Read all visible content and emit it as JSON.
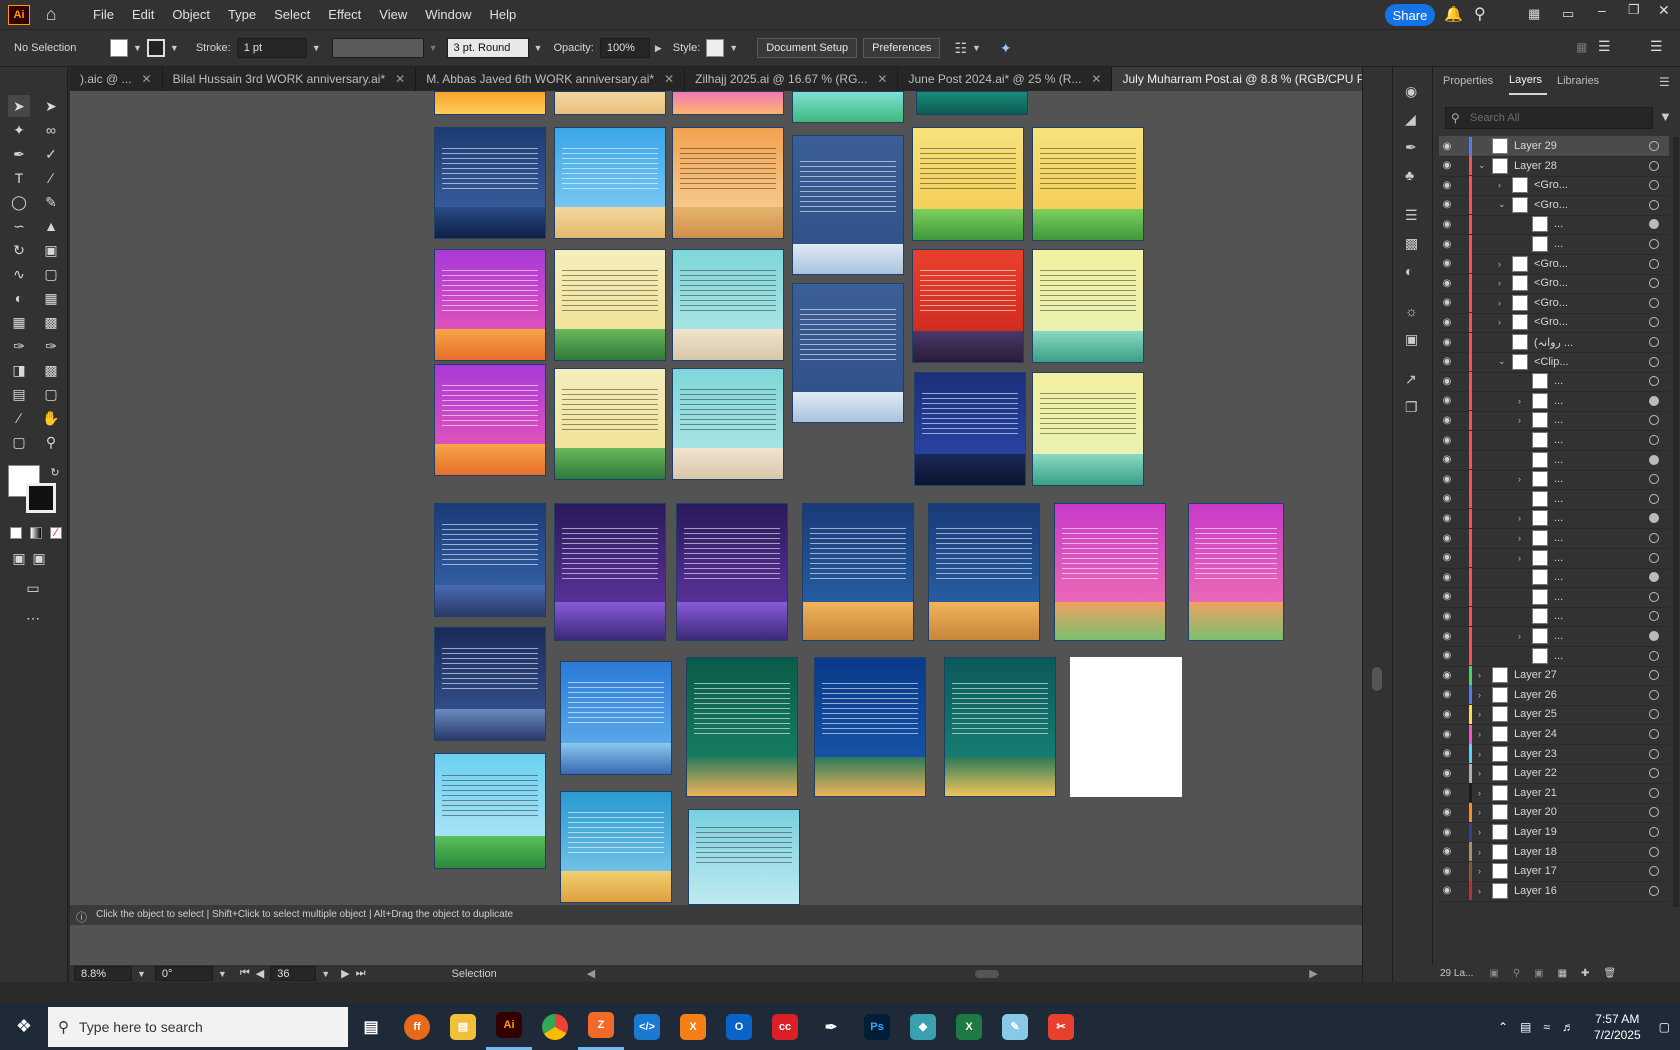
{
  "app": {
    "logo": "Ai"
  },
  "menu": [
    "File",
    "Edit",
    "Object",
    "Type",
    "Select",
    "Effect",
    "View",
    "Window",
    "Help"
  ],
  "share_label": "Share",
  "control": {
    "selection": "No Selection",
    "stroke_label": "Stroke:",
    "stroke_value": "1 pt",
    "brush": "3 pt. Round",
    "opacity_label": "Opacity:",
    "opacity_value": "100%",
    "style_label": "Style:",
    "document_setup": "Document Setup",
    "preferences": "Preferences"
  },
  "tabs": [
    {
      "label": ").aic @ ..."
    },
    {
      "label": "Bilal Hussain  3rd  WORK anniversary.ai*"
    },
    {
      "label": "M. Abbas Javed  6th  WORK anniversary.ai*"
    },
    {
      "label": "Zilhajj 2025.ai @ 16.67 % (RG..."
    },
    {
      "label": "June Post 2024.ai* @ 25 % (R..."
    },
    {
      "label": "July Muharram Post.ai @ 8.8 % (RGB/CPU Preview)"
    }
  ],
  "status": {
    "hint": "Click the object to select  |  Shift+Click to select multiple object  |  Alt+Drag the object to duplicate",
    "zoom": "8.8%",
    "rotation": "0°",
    "artboard": "36",
    "tool": "Selection"
  },
  "panel": {
    "tabs": [
      "Properties",
      "Layers",
      "Libraries"
    ],
    "search_placeholder": "Search All",
    "layer_count": "29 La...",
    "layers": [
      {
        "name": "Layer 29",
        "color": "#4f7cff",
        "selected": true,
        "twist": "",
        "indent": 0
      },
      {
        "name": "Layer 28",
        "color": "#ff5050",
        "twist": "v",
        "indent": 0
      },
      {
        "name": "<Gro...",
        "color": "#ff5050",
        "twist": ">",
        "indent": 1
      },
      {
        "name": "<Gro...",
        "color": "#ff5050",
        "twist": "v",
        "indent": 1
      },
      {
        "name": "...",
        "color": "#ff5050",
        "twist": "",
        "indent": 2
      },
      {
        "name": "...",
        "color": "#ff5050",
        "twist": "",
        "indent": 2
      },
      {
        "name": "<Gro...",
        "color": "#ff5050",
        "twist": ">",
        "indent": 1
      },
      {
        "name": "<Gro...",
        "color": "#ff5050",
        "twist": ">",
        "indent": 1
      },
      {
        "name": "<Gro...",
        "color": "#ff5050",
        "twist": ">",
        "indent": 1
      },
      {
        "name": "<Gro...",
        "color": "#ff5050",
        "twist": ">",
        "indent": 1
      },
      {
        "name": "(روانہ ...",
        "color": "#ff5050",
        "twist": "",
        "indent": 1
      },
      {
        "name": "<Clip...",
        "color": "#ff5050",
        "twist": "v",
        "indent": 1
      },
      {
        "name": "...",
        "color": "#ff5050",
        "twist": "",
        "indent": 2
      },
      {
        "name": "...",
        "color": "#ff5050",
        "twist": ">",
        "indent": 2
      },
      {
        "name": "...",
        "color": "#ff5050",
        "twist": ">",
        "indent": 2
      },
      {
        "name": "...",
        "color": "#ff5050",
        "twist": "",
        "indent": 2
      },
      {
        "name": "...",
        "color": "#ff5050",
        "twist": "",
        "indent": 2
      },
      {
        "name": "...",
        "color": "#ff5050",
        "twist": ">",
        "indent": 2
      },
      {
        "name": "...",
        "color": "#ff5050",
        "twist": "",
        "indent": 2
      },
      {
        "name": "...",
        "color": "#ff5050",
        "twist": ">",
        "indent": 2
      },
      {
        "name": "...",
        "color": "#ff5050",
        "twist": ">",
        "indent": 2
      },
      {
        "name": "...",
        "color": "#ff5050",
        "twist": ">",
        "indent": 2
      },
      {
        "name": "...",
        "color": "#ff5050",
        "twist": "",
        "indent": 2
      },
      {
        "name": "...",
        "color": "#ff5050",
        "twist": "",
        "indent": 2
      },
      {
        "name": "...",
        "color": "#ff5050",
        "twist": "",
        "indent": 2
      },
      {
        "name": "...",
        "color": "#ff5050",
        "twist": ">",
        "indent": 2
      },
      {
        "name": "...",
        "color": "#ff5050",
        "twist": "",
        "indent": 2
      },
      {
        "name": "Layer 27",
        "color": "#3ddc5a",
        "twist": ">",
        "indent": 0
      },
      {
        "name": "Layer 26",
        "color": "#4f7cff",
        "twist": ">",
        "indent": 0
      },
      {
        "name": "Layer 25",
        "color": "#ffdf3d",
        "twist": ">",
        "indent": 0
      },
      {
        "name": "Layer 24",
        "color": "#ff4fd8",
        "twist": ">",
        "indent": 0
      },
      {
        "name": "Layer 23",
        "color": "#4fd8ff",
        "twist": ">",
        "indent": 0
      },
      {
        "name": "Layer 22",
        "color": "#b0b0b0",
        "twist": ">",
        "indent": 0
      },
      {
        "name": "Layer 21",
        "color": "#1a1a1a",
        "twist": ">",
        "indent": 0
      },
      {
        "name": "Layer 20",
        "color": "#ff8a2a",
        "twist": ">",
        "indent": 0
      },
      {
        "name": "Layer 19",
        "color": "#3a3aa0",
        "twist": ">",
        "indent": 0
      },
      {
        "name": "Layer 18",
        "color": "#b09060",
        "twist": ">",
        "indent": 0
      },
      {
        "name": "Layer 17",
        "color": "#8a5a2a",
        "twist": ">",
        "indent": 0
      },
      {
        "name": "Layer 16",
        "color": "#c03030",
        "twist": ">",
        "indent": 0
      }
    ]
  },
  "taskbar": {
    "search_placeholder": "Type here to search",
    "time": "7:57 AM",
    "date": "7/2/2025"
  }
}
